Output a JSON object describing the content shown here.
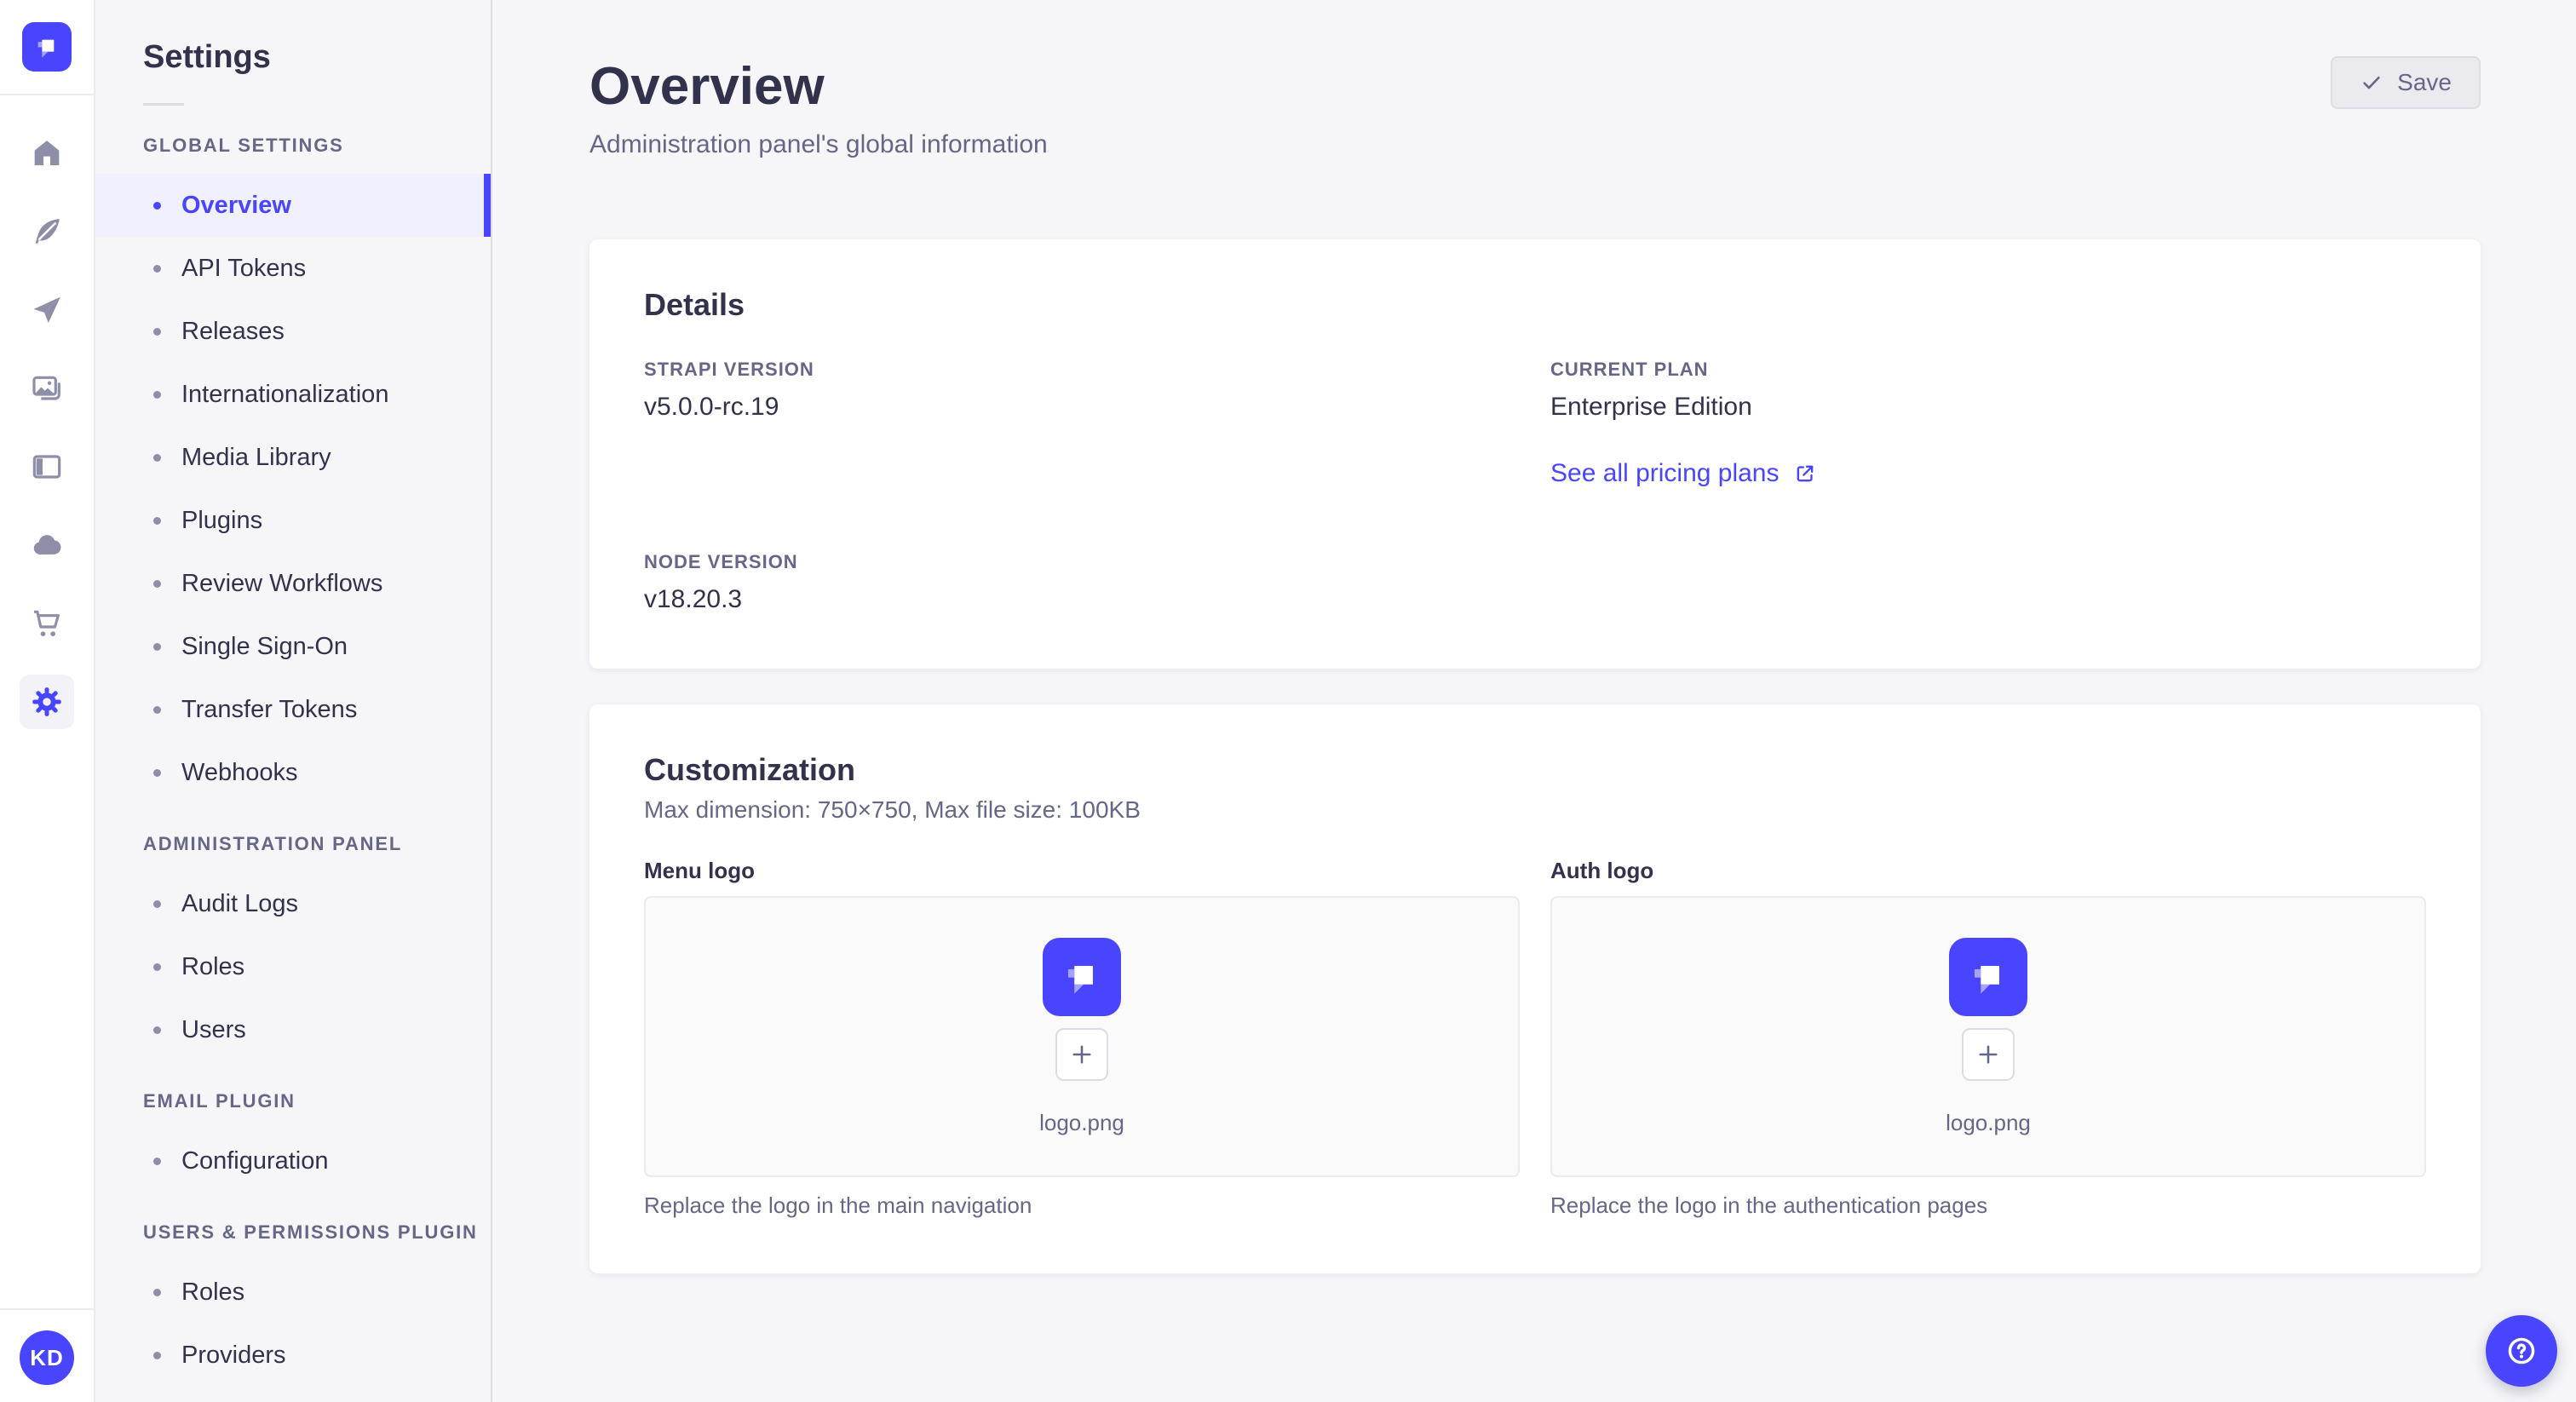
{
  "colors": {
    "primary": "#4945ff",
    "active_item_bg": "#f0f0ff",
    "text_primary": "#32324d",
    "text_muted": "#666687",
    "page_bg": "#f6f6f9"
  },
  "rail": {
    "icons": [
      "strapi-logo",
      "home",
      "feather",
      "paper-plane",
      "pictures",
      "layout",
      "cloud",
      "cart",
      "gear"
    ],
    "active_icon": "gear",
    "avatar_initials": "KD"
  },
  "subnav": {
    "title": "Settings",
    "sections": [
      {
        "label": "GLOBAL SETTINGS",
        "items": [
          {
            "label": "Overview",
            "active": true
          },
          {
            "label": "API Tokens"
          },
          {
            "label": "Releases"
          },
          {
            "label": "Internationalization"
          },
          {
            "label": "Media Library"
          },
          {
            "label": "Plugins"
          },
          {
            "label": "Review Workflows"
          },
          {
            "label": "Single Sign-On"
          },
          {
            "label": "Transfer Tokens"
          },
          {
            "label": "Webhooks"
          }
        ]
      },
      {
        "label": "ADMINISTRATION PANEL",
        "items": [
          {
            "label": "Audit Logs"
          },
          {
            "label": "Roles"
          },
          {
            "label": "Users"
          }
        ]
      },
      {
        "label": "EMAIL PLUGIN",
        "items": [
          {
            "label": "Configuration"
          }
        ]
      },
      {
        "label": "USERS & PERMISSIONS PLUGIN",
        "items": [
          {
            "label": "Roles"
          },
          {
            "label": "Providers"
          }
        ]
      }
    ]
  },
  "header": {
    "title": "Overview",
    "subtitle": "Administration panel's global information",
    "save_label": "Save"
  },
  "details": {
    "heading": "Details",
    "strapi_version": {
      "label": "STRAPI VERSION",
      "value": "v5.0.0-rc.19"
    },
    "current_plan": {
      "label": "CURRENT PLAN",
      "value": "Enterprise Edition"
    },
    "node_version": {
      "label": "NODE VERSION",
      "value": "v18.20.3"
    },
    "pricing_link_label": "See all pricing plans"
  },
  "customization": {
    "heading": "Customization",
    "subheading": "Max dimension: 750×750, Max file size: 100KB",
    "menu_logo": {
      "label": "Menu logo",
      "filename": "logo.png",
      "caption": "Replace the logo in the main navigation"
    },
    "auth_logo": {
      "label": "Auth logo",
      "filename": "logo.png",
      "caption": "Replace the logo in the authentication pages"
    }
  }
}
